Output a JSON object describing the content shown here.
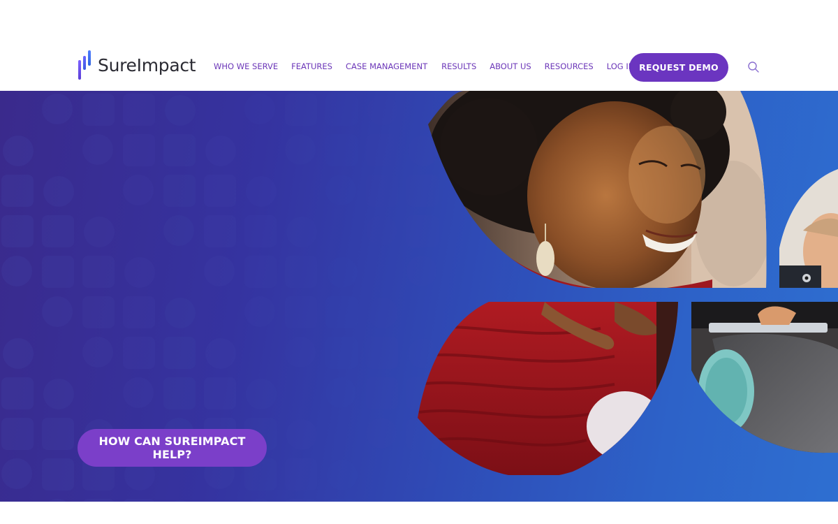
{
  "brand": {
    "name": "SureImpact"
  },
  "nav": {
    "items": [
      {
        "label": "WHO WE SERVE"
      },
      {
        "label": "FEATURES"
      },
      {
        "label": "CASE MANAGEMENT"
      },
      {
        "label": "RESULTS"
      },
      {
        "label": "ABOUT US"
      },
      {
        "label": "RESOURCES"
      },
      {
        "label": "LOG IN"
      }
    ],
    "demo_label": "REQUEST DEMO",
    "search_icon": "search-icon"
  },
  "hero": {
    "cta_label": "HOW CAN SUREIMPACT HELP?"
  },
  "colors": {
    "brand_purple": "#6b35c0",
    "cta_purple": "#7b3fc9",
    "nav_text": "#6b36b8",
    "hero_blue": "#2f4ab5"
  }
}
